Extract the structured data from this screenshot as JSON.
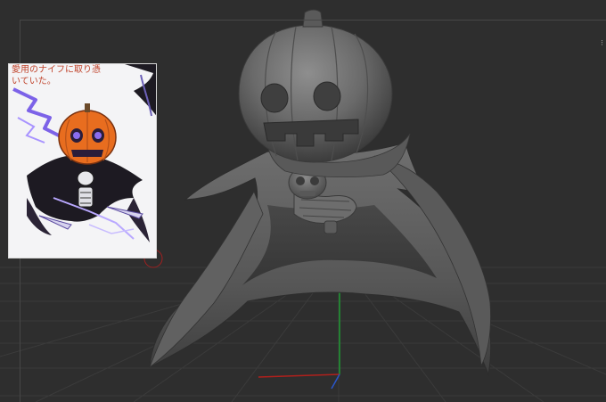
{
  "viewport": {
    "background": "#2e2e2e",
    "grid_color": "#3a3a3a",
    "axis_x_color": "#b0201c",
    "axis_y_color": "#1e9a32",
    "axis_z_color": "#2a56c8",
    "model": "pumpkin-head ghost sculpt",
    "model_color": "#6c6c6c"
  },
  "reference_image": {
    "caption": "愛用のナイフに取り憑\nいていた。",
    "caption_color": "#c0442c",
    "pumpkin_color": "#e86d1f",
    "eye_glow_color": "#8a6cf0",
    "cloak_color": "#1d1a22"
  },
  "ui_edge": {
    "mark": "⁝"
  }
}
